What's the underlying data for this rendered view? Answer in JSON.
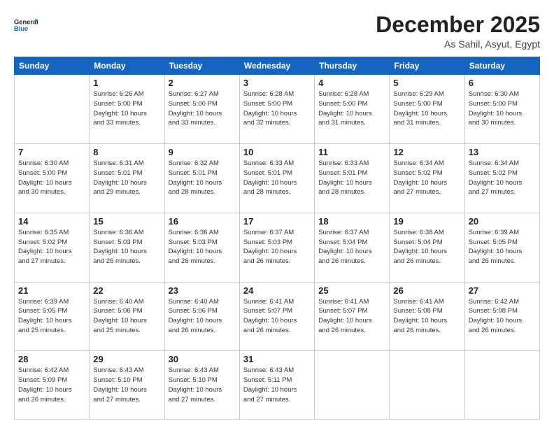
{
  "header": {
    "logo_general": "General",
    "logo_blue": "Blue",
    "month_year": "December 2025",
    "location": "As Sahil, Asyut, Egypt"
  },
  "weekdays": [
    "Sunday",
    "Monday",
    "Tuesday",
    "Wednesday",
    "Thursday",
    "Friday",
    "Saturday"
  ],
  "weeks": [
    [
      {
        "day": "",
        "info": ""
      },
      {
        "day": "1",
        "info": "Sunrise: 6:26 AM\nSunset: 5:00 PM\nDaylight: 10 hours\nand 33 minutes."
      },
      {
        "day": "2",
        "info": "Sunrise: 6:27 AM\nSunset: 5:00 PM\nDaylight: 10 hours\nand 33 minutes."
      },
      {
        "day": "3",
        "info": "Sunrise: 6:28 AM\nSunset: 5:00 PM\nDaylight: 10 hours\nand 32 minutes."
      },
      {
        "day": "4",
        "info": "Sunrise: 6:28 AM\nSunset: 5:00 PM\nDaylight: 10 hours\nand 31 minutes."
      },
      {
        "day": "5",
        "info": "Sunrise: 6:29 AM\nSunset: 5:00 PM\nDaylight: 10 hours\nand 31 minutes."
      },
      {
        "day": "6",
        "info": "Sunrise: 6:30 AM\nSunset: 5:00 PM\nDaylight: 10 hours\nand 30 minutes."
      }
    ],
    [
      {
        "day": "7",
        "info": "Sunrise: 6:30 AM\nSunset: 5:00 PM\nDaylight: 10 hours\nand 30 minutes."
      },
      {
        "day": "8",
        "info": "Sunrise: 6:31 AM\nSunset: 5:01 PM\nDaylight: 10 hours\nand 29 minutes."
      },
      {
        "day": "9",
        "info": "Sunrise: 6:32 AM\nSunset: 5:01 PM\nDaylight: 10 hours\nand 28 minutes."
      },
      {
        "day": "10",
        "info": "Sunrise: 6:33 AM\nSunset: 5:01 PM\nDaylight: 10 hours\nand 28 minutes."
      },
      {
        "day": "11",
        "info": "Sunrise: 6:33 AM\nSunset: 5:01 PM\nDaylight: 10 hours\nand 28 minutes."
      },
      {
        "day": "12",
        "info": "Sunrise: 6:34 AM\nSunset: 5:02 PM\nDaylight: 10 hours\nand 27 minutes."
      },
      {
        "day": "13",
        "info": "Sunrise: 6:34 AM\nSunset: 5:02 PM\nDaylight: 10 hours\nand 27 minutes."
      }
    ],
    [
      {
        "day": "14",
        "info": "Sunrise: 6:35 AM\nSunset: 5:02 PM\nDaylight: 10 hours\nand 27 minutes."
      },
      {
        "day": "15",
        "info": "Sunrise: 6:36 AM\nSunset: 5:03 PM\nDaylight: 10 hours\nand 26 minutes."
      },
      {
        "day": "16",
        "info": "Sunrise: 6:36 AM\nSunset: 5:03 PM\nDaylight: 10 hours\nand 26 minutes."
      },
      {
        "day": "17",
        "info": "Sunrise: 6:37 AM\nSunset: 5:03 PM\nDaylight: 10 hours\nand 26 minutes."
      },
      {
        "day": "18",
        "info": "Sunrise: 6:37 AM\nSunset: 5:04 PM\nDaylight: 10 hours\nand 26 minutes."
      },
      {
        "day": "19",
        "info": "Sunrise: 6:38 AM\nSunset: 5:04 PM\nDaylight: 10 hours\nand 26 minutes."
      },
      {
        "day": "20",
        "info": "Sunrise: 6:39 AM\nSunset: 5:05 PM\nDaylight: 10 hours\nand 26 minutes."
      }
    ],
    [
      {
        "day": "21",
        "info": "Sunrise: 6:39 AM\nSunset: 5:05 PM\nDaylight: 10 hours\nand 25 minutes."
      },
      {
        "day": "22",
        "info": "Sunrise: 6:40 AM\nSunset: 5:06 PM\nDaylight: 10 hours\nand 25 minutes."
      },
      {
        "day": "23",
        "info": "Sunrise: 6:40 AM\nSunset: 5:06 PM\nDaylight: 10 hours\nand 26 minutes."
      },
      {
        "day": "24",
        "info": "Sunrise: 6:41 AM\nSunset: 5:07 PM\nDaylight: 10 hours\nand 26 minutes."
      },
      {
        "day": "25",
        "info": "Sunrise: 6:41 AM\nSunset: 5:07 PM\nDaylight: 10 hours\nand 26 minutes."
      },
      {
        "day": "26",
        "info": "Sunrise: 6:41 AM\nSunset: 5:08 PM\nDaylight: 10 hours\nand 26 minutes."
      },
      {
        "day": "27",
        "info": "Sunrise: 6:42 AM\nSunset: 5:08 PM\nDaylight: 10 hours\nand 26 minutes."
      }
    ],
    [
      {
        "day": "28",
        "info": "Sunrise: 6:42 AM\nSunset: 5:09 PM\nDaylight: 10 hours\nand 26 minutes."
      },
      {
        "day": "29",
        "info": "Sunrise: 6:43 AM\nSunset: 5:10 PM\nDaylight: 10 hours\nand 27 minutes."
      },
      {
        "day": "30",
        "info": "Sunrise: 6:43 AM\nSunset: 5:10 PM\nDaylight: 10 hours\nand 27 minutes."
      },
      {
        "day": "31",
        "info": "Sunrise: 6:43 AM\nSunset: 5:11 PM\nDaylight: 10 hours\nand 27 minutes."
      },
      {
        "day": "",
        "info": ""
      },
      {
        "day": "",
        "info": ""
      },
      {
        "day": "",
        "info": ""
      }
    ]
  ]
}
